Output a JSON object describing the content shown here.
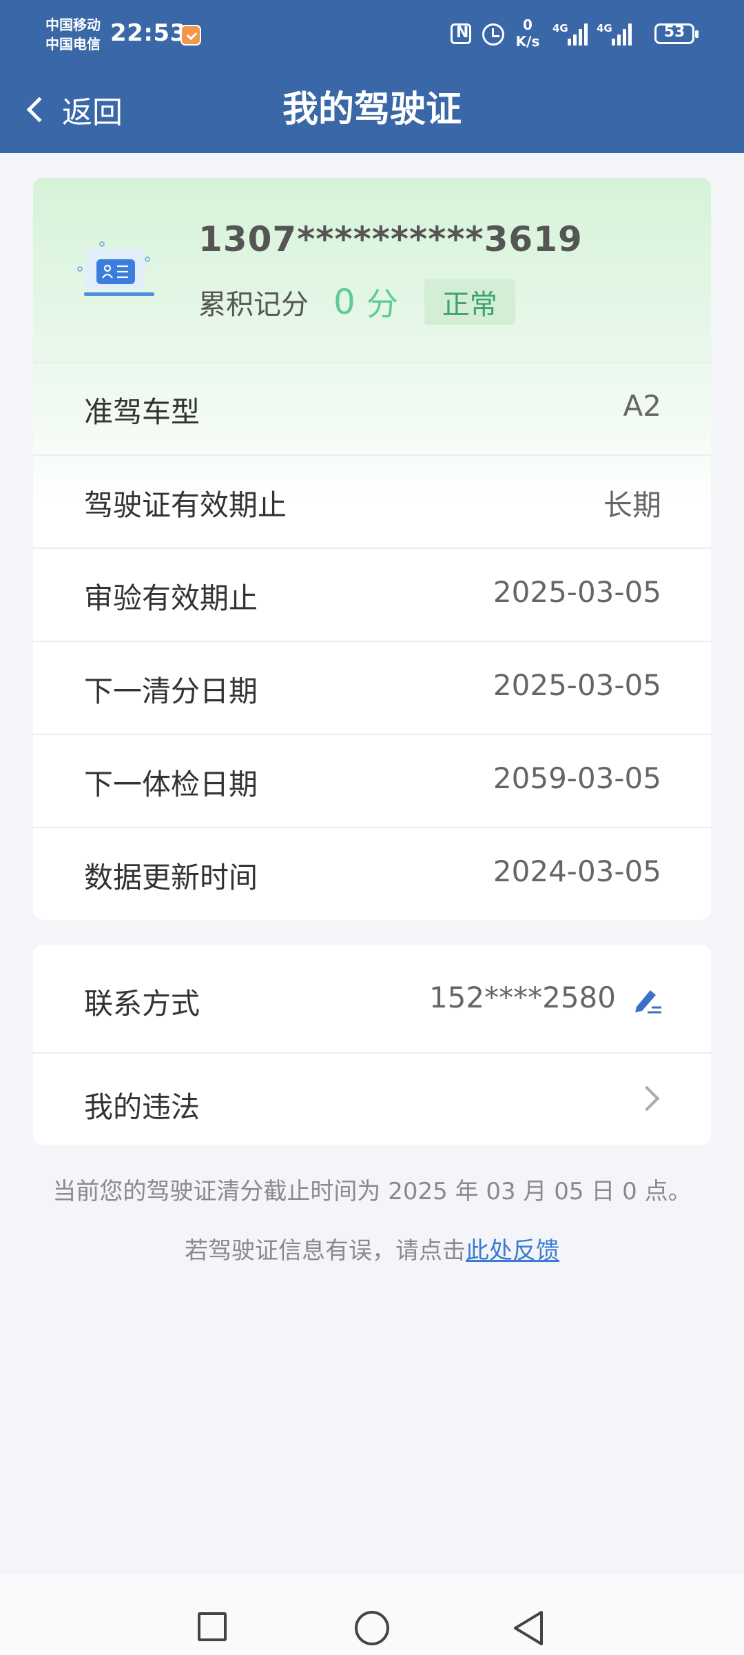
{
  "status_bar": {
    "carrier_1": "中国移动",
    "carrier_2": "中国电信",
    "time": "22:53",
    "net_speed_value": "0",
    "net_speed_unit": "K/s",
    "signal_1_label": "4G",
    "signal_2_label": "4G",
    "battery": "53"
  },
  "header": {
    "back_label": "返回",
    "title": "我的驾驶证"
  },
  "license": {
    "number": "1307**********3619",
    "points_label": "累积记分",
    "points_value": "0",
    "points_unit": "分",
    "status": "正常",
    "icon_name": "driver-license-icon",
    "accent_color": "#5fcc95"
  },
  "details": [
    {
      "label": "准驾车型",
      "value": "A2"
    },
    {
      "label": "驾驶证有效期止",
      "value": "长期"
    },
    {
      "label": "审验有效期止",
      "value": "2025-03-05"
    },
    {
      "label": "下一清分日期",
      "value": "2025-03-05"
    },
    {
      "label": "下一体检日期",
      "value": "2059-03-05"
    },
    {
      "label": "数据更新时间",
      "value": "2024-03-05"
    }
  ],
  "contact": {
    "label": "联系方式",
    "value": "152****2580",
    "edit_icon": "edit-icon"
  },
  "violations": {
    "label": "我的违法"
  },
  "notes": {
    "deadline": "当前您的驾驶证清分截止时间为 2025 年 03 月 05 日 0 点。",
    "feedback_prefix": "若驾驶证信息有误，请点击",
    "feedback_link": "此处反馈"
  },
  "theme": {
    "header_color": "#3a67a7",
    "link_color": "#3a7bd5"
  }
}
